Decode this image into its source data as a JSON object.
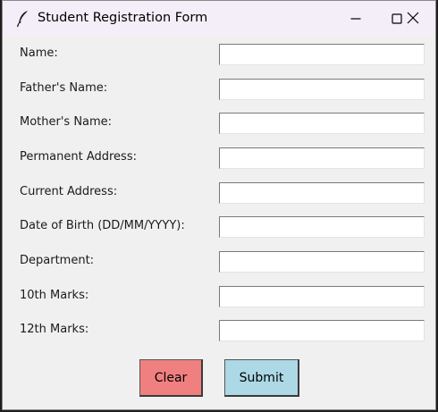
{
  "window": {
    "title": "Student Registration Form",
    "icons": {
      "app": "feather-icon",
      "minimize": "minimize-icon",
      "maximize": "maximize-icon",
      "close": "close-icon"
    }
  },
  "form": {
    "fields": [
      {
        "label": "Name:",
        "value": ""
      },
      {
        "label": "Father's Name:",
        "value": ""
      },
      {
        "label": "Mother's Name:",
        "value": ""
      },
      {
        "label": "Permanent Address:",
        "value": ""
      },
      {
        "label": "Current Address:",
        "value": ""
      },
      {
        "label": "Date of Birth (DD/MM/YYYY):",
        "value": ""
      },
      {
        "label": "Department:",
        "value": ""
      },
      {
        "label": "10th Marks:",
        "value": ""
      },
      {
        "label": "12th Marks:",
        "value": ""
      }
    ],
    "buttons": {
      "clear": {
        "label": "Clear",
        "color": "#f08080"
      },
      "submit": {
        "label": "Submit",
        "color": "#add8e6"
      }
    }
  }
}
